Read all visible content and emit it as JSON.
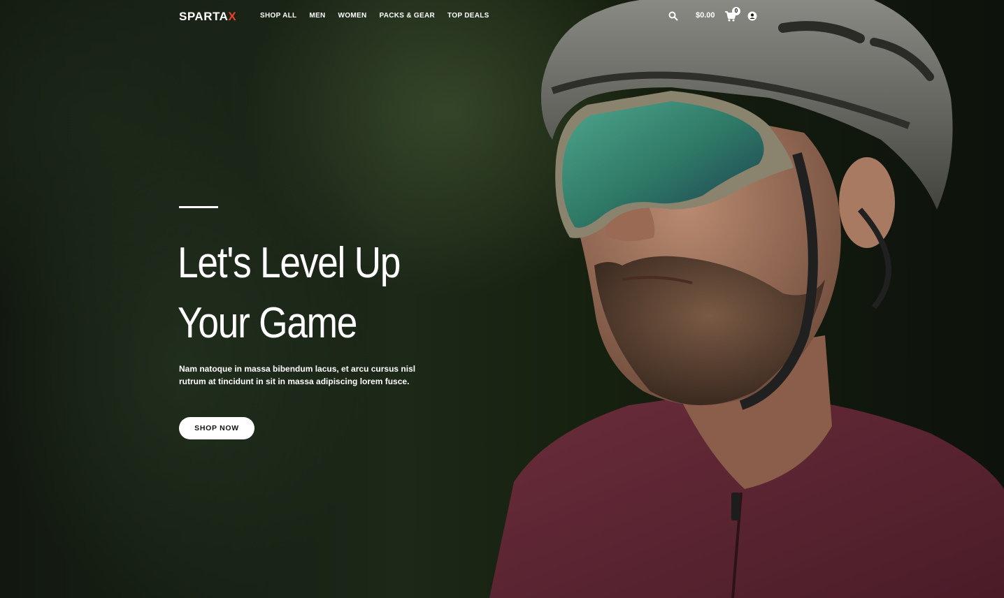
{
  "brand": {
    "name": "SPARTA",
    "accent_letter": "X",
    "accent_color": "#e8432a"
  },
  "nav": {
    "items": [
      {
        "label": "SHOP ALL"
      },
      {
        "label": "MEN"
      },
      {
        "label": "WOMEN"
      },
      {
        "label": "PACKS & GEAR"
      },
      {
        "label": "TOP DEALS"
      }
    ]
  },
  "header_actions": {
    "search_icon": "search-icon",
    "cart_total": "$0.00",
    "cart_icon": "cart-icon",
    "cart_count": "0",
    "account_icon": "account-icon"
  },
  "hero": {
    "title": "Let's Level Up Your Game",
    "text": "Nam natoque in massa bibendum lacus, et arcu cursus nisl rutrum at tincidunt in sit in massa adipiscing lorem fusce.",
    "button_label": "SHOP NOW"
  }
}
